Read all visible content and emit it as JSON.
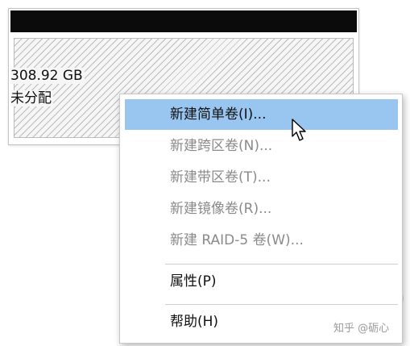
{
  "partition": {
    "size_text": "308.92 GB",
    "status_text": "未分配"
  },
  "context_menu": {
    "items": [
      {
        "label": "新建简单卷(I)...",
        "enabled": true,
        "highlighted": true
      },
      {
        "label": "新建跨区卷(N)...",
        "enabled": false
      },
      {
        "label": "新建带区卷(T)...",
        "enabled": false
      },
      {
        "label": "新建镜像卷(R)...",
        "enabled": false
      },
      {
        "label": "新建 RAID-5 卷(W)...",
        "enabled": false
      },
      {
        "label": "属性(P)",
        "enabled": true
      },
      {
        "label": "帮助(H)",
        "enabled": true
      }
    ]
  },
  "watermark": {
    "text": "知乎 @砺心"
  },
  "icons": {
    "cursor": "arrow-cursor-icon",
    "watermark": "wechat-icon"
  },
  "colors": {
    "highlight": "#99c6f1",
    "disabled_text": "#8a8a8a",
    "header_bar": "#0b0b0b",
    "hatch": "#bcbcbc"
  }
}
